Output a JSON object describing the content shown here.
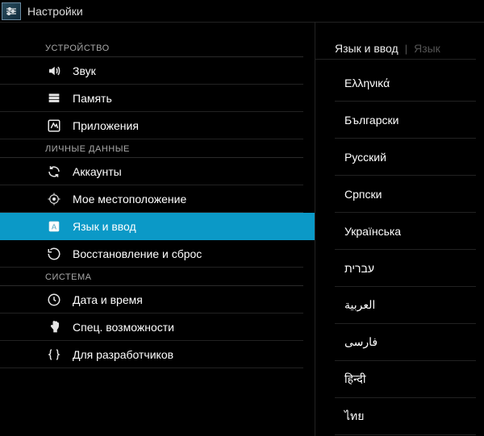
{
  "app_title": "Настройки",
  "sections": {
    "device": {
      "header": "УСТРОЙСТВО",
      "items": {
        "sound": "Звук",
        "storage": "Память",
        "apps": "Приложения"
      }
    },
    "personal": {
      "header": "ЛИЧНЫЕ ДАННЫЕ",
      "items": {
        "accounts": "Аккаунты",
        "location": "Мое местоположение",
        "language_input": "Язык и ввод",
        "backup_reset": "Восстановление и сброс"
      }
    },
    "system": {
      "header": "СИСТЕМА",
      "items": {
        "datetime": "Дата и время",
        "accessibility": "Спец. возможности",
        "developer": "Для разработчиков"
      }
    }
  },
  "right_panel": {
    "breadcrumb_primary": "Язык и ввод",
    "breadcrumb_secondary": "Язык",
    "languages": [
      "Ελληνικά",
      "Български",
      "Русский",
      "Српски",
      "Українська",
      "עברית",
      "العربية",
      "فارسی",
      "हिन्दी",
      "ไทย"
    ]
  }
}
